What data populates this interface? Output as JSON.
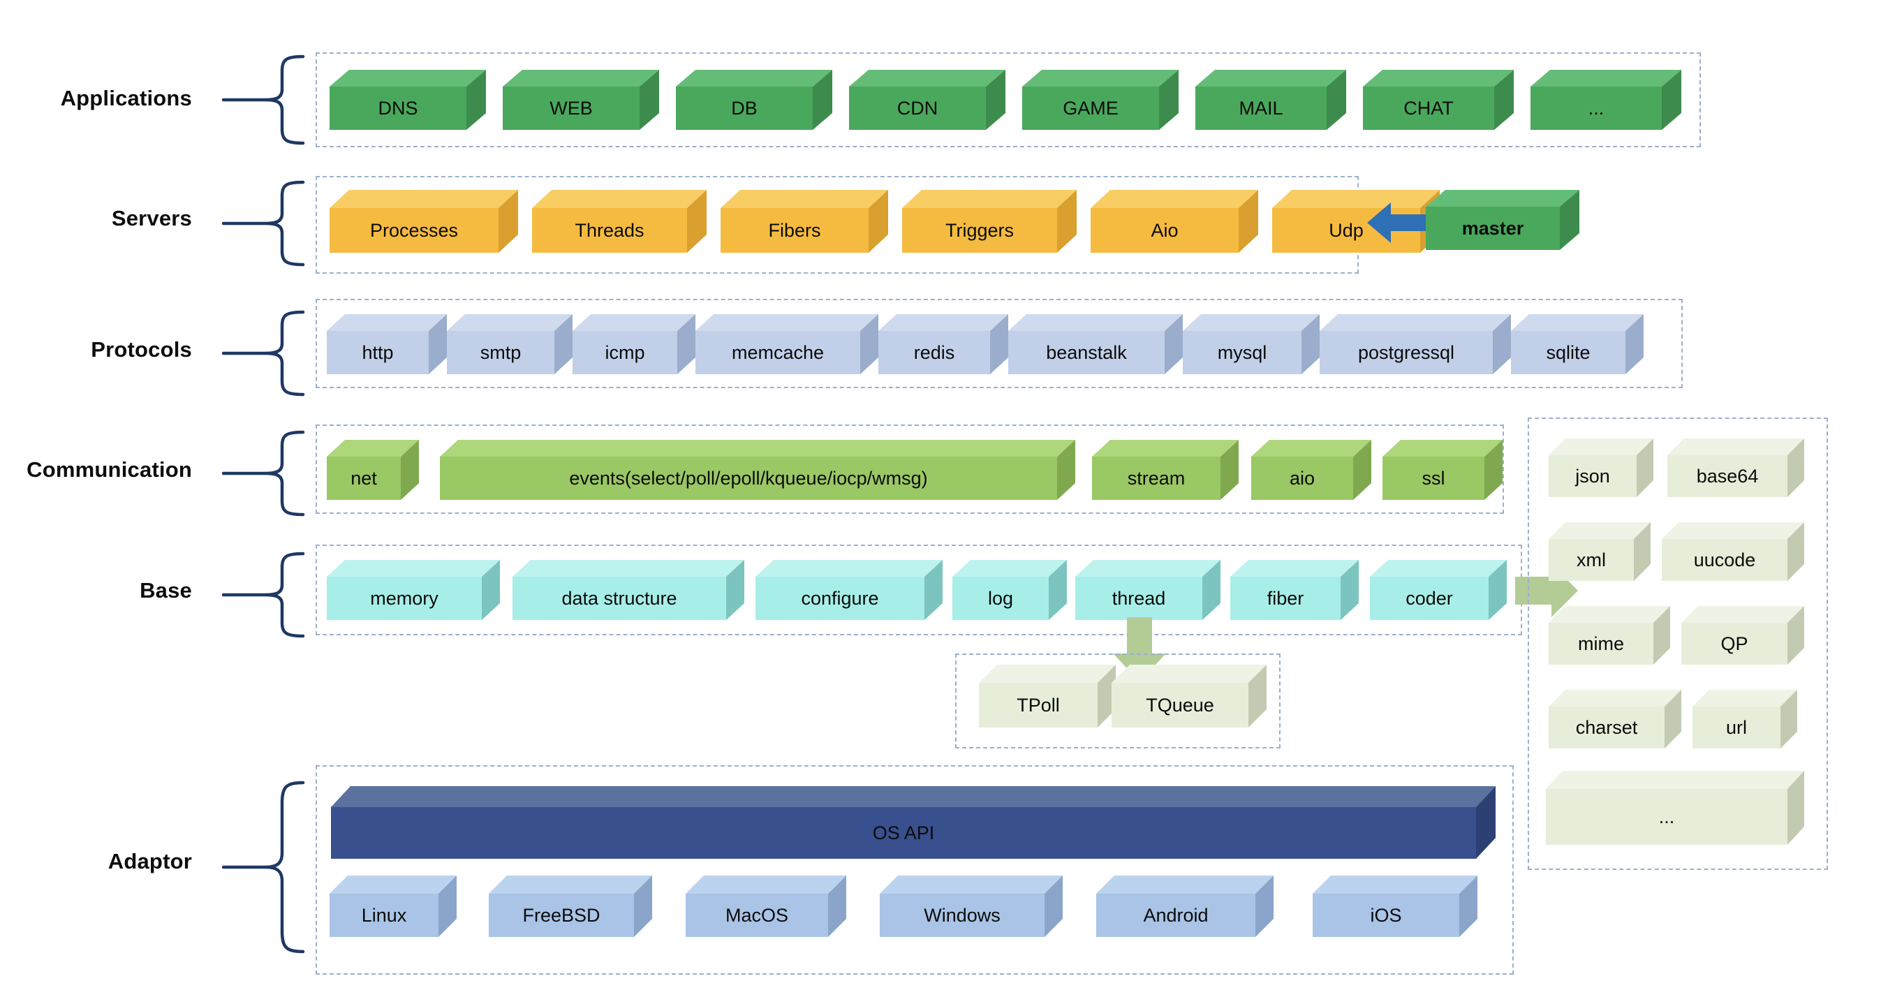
{
  "diagram": {
    "title": "acl library architecture layers",
    "rows": [
      {
        "id": "applications",
        "label": "Applications",
        "palette": "green",
        "items": [
          {
            "label": "DNS"
          },
          {
            "label": "WEB"
          },
          {
            "label": "DB"
          },
          {
            "label": "CDN"
          },
          {
            "label": "GAME"
          },
          {
            "label": "MAIL"
          },
          {
            "label": "CHAT"
          },
          {
            "label": "..."
          }
        ]
      },
      {
        "id": "servers",
        "label": "Servers",
        "palette": "orange",
        "items": [
          {
            "label": "Processes"
          },
          {
            "label": "Threads"
          },
          {
            "label": "Fibers"
          },
          {
            "label": "Triggers"
          },
          {
            "label": "Aio"
          },
          {
            "label": "Udp"
          }
        ],
        "aside": {
          "label": "master",
          "palette": "green",
          "bold": true
        },
        "arrow": {
          "name": "master-arrow",
          "direction": "left",
          "color": "#2f6fb5"
        }
      },
      {
        "id": "protocols",
        "label": "Protocols",
        "palette": "steelblue",
        "items": [
          {
            "label": "http"
          },
          {
            "label": "smtp"
          },
          {
            "label": "icmp"
          },
          {
            "label": "memcache"
          },
          {
            "label": "redis"
          },
          {
            "label": "beanstalk"
          },
          {
            "label": "mysql"
          },
          {
            "label": "postgressql"
          },
          {
            "label": "sqlite"
          }
        ]
      },
      {
        "id": "communication",
        "label": "Communication",
        "palette": "lightgreen",
        "items": [
          {
            "label": "net"
          },
          {
            "label": "events(select/poll/epoll/kqueue/iocp/wmsg)"
          },
          {
            "label": "stream"
          },
          {
            "label": "aio"
          },
          {
            "label": "ssl"
          }
        ]
      },
      {
        "id": "base",
        "label": "Base",
        "palette": "cyan",
        "items": [
          {
            "label": "memory"
          },
          {
            "label": "data structure"
          },
          {
            "label": "configure"
          },
          {
            "label": "log"
          },
          {
            "label": "thread"
          },
          {
            "label": "fiber"
          },
          {
            "label": "coder"
          }
        ]
      },
      {
        "id": "adaptor",
        "label": "Adaptor",
        "palette": "blue",
        "bar": {
          "label": "OS API"
        },
        "items": [
          {
            "label": "Linux"
          },
          {
            "label": "FreeBSD"
          },
          {
            "label": "MacOS"
          },
          {
            "label": "Windows"
          },
          {
            "label": "Android"
          },
          {
            "label": "iOS"
          }
        ]
      }
    ],
    "thread_group": {
      "id": "thread-subgroup",
      "palette": "paleolive",
      "items": [
        {
          "label": "TPoll"
        },
        {
          "label": "TQueue"
        }
      ],
      "arrow": {
        "name": "thread-down-arrow",
        "direction": "down",
        "color": "#b3cc96"
      }
    },
    "coder_group": {
      "id": "coder-panel",
      "palette": "paleolive",
      "arrow": {
        "name": "coder-right-arrow",
        "direction": "right",
        "color": "#b3cc96"
      },
      "items": [
        {
          "label": "json"
        },
        {
          "label": "base64"
        },
        {
          "label": "xml"
        },
        {
          "label": "uucode"
        },
        {
          "label": "mime"
        },
        {
          "label": "QP"
        },
        {
          "label": "charset"
        },
        {
          "label": "url"
        },
        {
          "label": "..."
        }
      ]
    },
    "colors": {
      "green_front": "#4aa85c",
      "green_top": "#63bd76",
      "green_side": "#3d8c4d",
      "orange_front": "#f5bb41",
      "orange_top": "#f8cd64",
      "orange_side": "#d9a02f",
      "steelblue_front": "#c2cfe8",
      "steelblue_top": "#cfdaef",
      "steelblue_side": "#9badcc",
      "lightgreen_front": "#9ac864",
      "lightgreen_top": "#aed77c",
      "lightgreen_side": "#80a94f",
      "cyan_front": "#a8eee8",
      "cyan_top": "#bdf3ee",
      "cyan_side": "#7cc4bf",
      "paleolive_front": "#e6eed9",
      "paleolive_top": "#eef3e6",
      "paleolive_side": "#c2cbb2",
      "blue_front": "#a9c4e6",
      "blue_top": "#bcd3ef",
      "blue_side": "#8aa5c9",
      "osapi_front": "#38508d",
      "osapi_top": "#5b719f",
      "osapi_side": "#2c4073",
      "brace": "#1f3864",
      "dash_border": "#9bb0cc",
      "label_text": "#0d0d0d",
      "arrow_blue": "#2f6fb5",
      "arrow_green": "#b3cc96"
    }
  }
}
